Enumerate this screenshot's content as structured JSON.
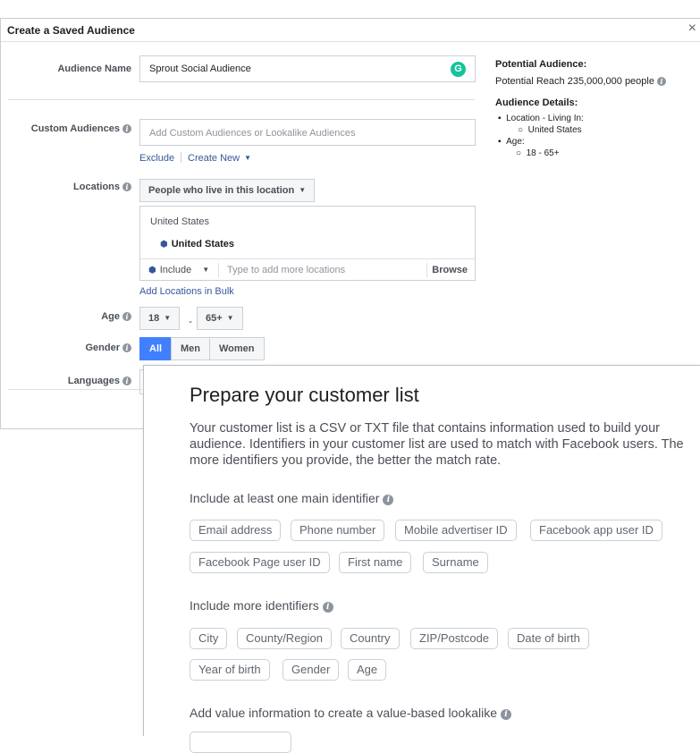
{
  "dialog": {
    "title": "Create a Saved Audience",
    "close": "×",
    "audience_name_label": "Audience Name",
    "audience_name_value": "Sprout Social Audience",
    "grammarly_badge": "G",
    "custom_audiences_label": "Custom Audiences",
    "custom_audiences_placeholder": "Add Custom Audiences or Lookalike Audiences",
    "exclude_link": "Exclude",
    "create_new_link": "Create New",
    "locations_label": "Locations",
    "locations_dropdown": "People who live in this location",
    "location_country_header": "United States",
    "location_selected": "United States",
    "include_dropdown": "Include",
    "location_input_placeholder": "Type to add more locations",
    "browse_button": "Browse",
    "add_bulk_link": "Add Locations in Bulk",
    "age_label": "Age",
    "age_min": "18",
    "age_dash": "-",
    "age_max": "65+",
    "gender_label": "Gender",
    "gender_options": [
      "All",
      "Men",
      "Women"
    ],
    "gender_selected": "All",
    "languages_label": "Languages",
    "info_glyph": "i"
  },
  "summary": {
    "potential_title": "Potential Audience:",
    "potential_reach": "Potential Reach 235,000,000 people",
    "details_title": "Audience Details:",
    "location_line": "Location - Living In:",
    "location_value": "United States",
    "age_line": "Age:",
    "age_value": "18 - 65+"
  },
  "customer_list": {
    "title": "Prepare your customer list",
    "description": "Your customer list is a CSV or TXT file that contains information used to build your audience. Identifiers in your customer list are used to match with Facebook users. The more identifiers you provide, the better the match rate.",
    "main_identifier_heading": "Include at least one main identifier",
    "main_identifiers": [
      "Email address",
      "Phone number",
      "Mobile advertiser ID",
      "Facebook app user ID",
      "Facebook Page user ID",
      "First name",
      "Surname"
    ],
    "more_identifiers_heading": "Include more identifiers",
    "more_identifiers": [
      "City",
      "County/Region",
      "Country",
      "ZIP/Postcode",
      "Date of birth",
      "Year of birth",
      "Gender",
      "Age"
    ],
    "value_heading": "Add value information to create a value-based lookalike"
  },
  "colors": {
    "accent": "#4080ff",
    "link": "#365899",
    "grammarly": "#15c39a"
  },
  "icons": {
    "close": "close-icon",
    "info": "info-icon",
    "location_pin": "location-pin-icon",
    "caret": "caret-down-icon"
  }
}
